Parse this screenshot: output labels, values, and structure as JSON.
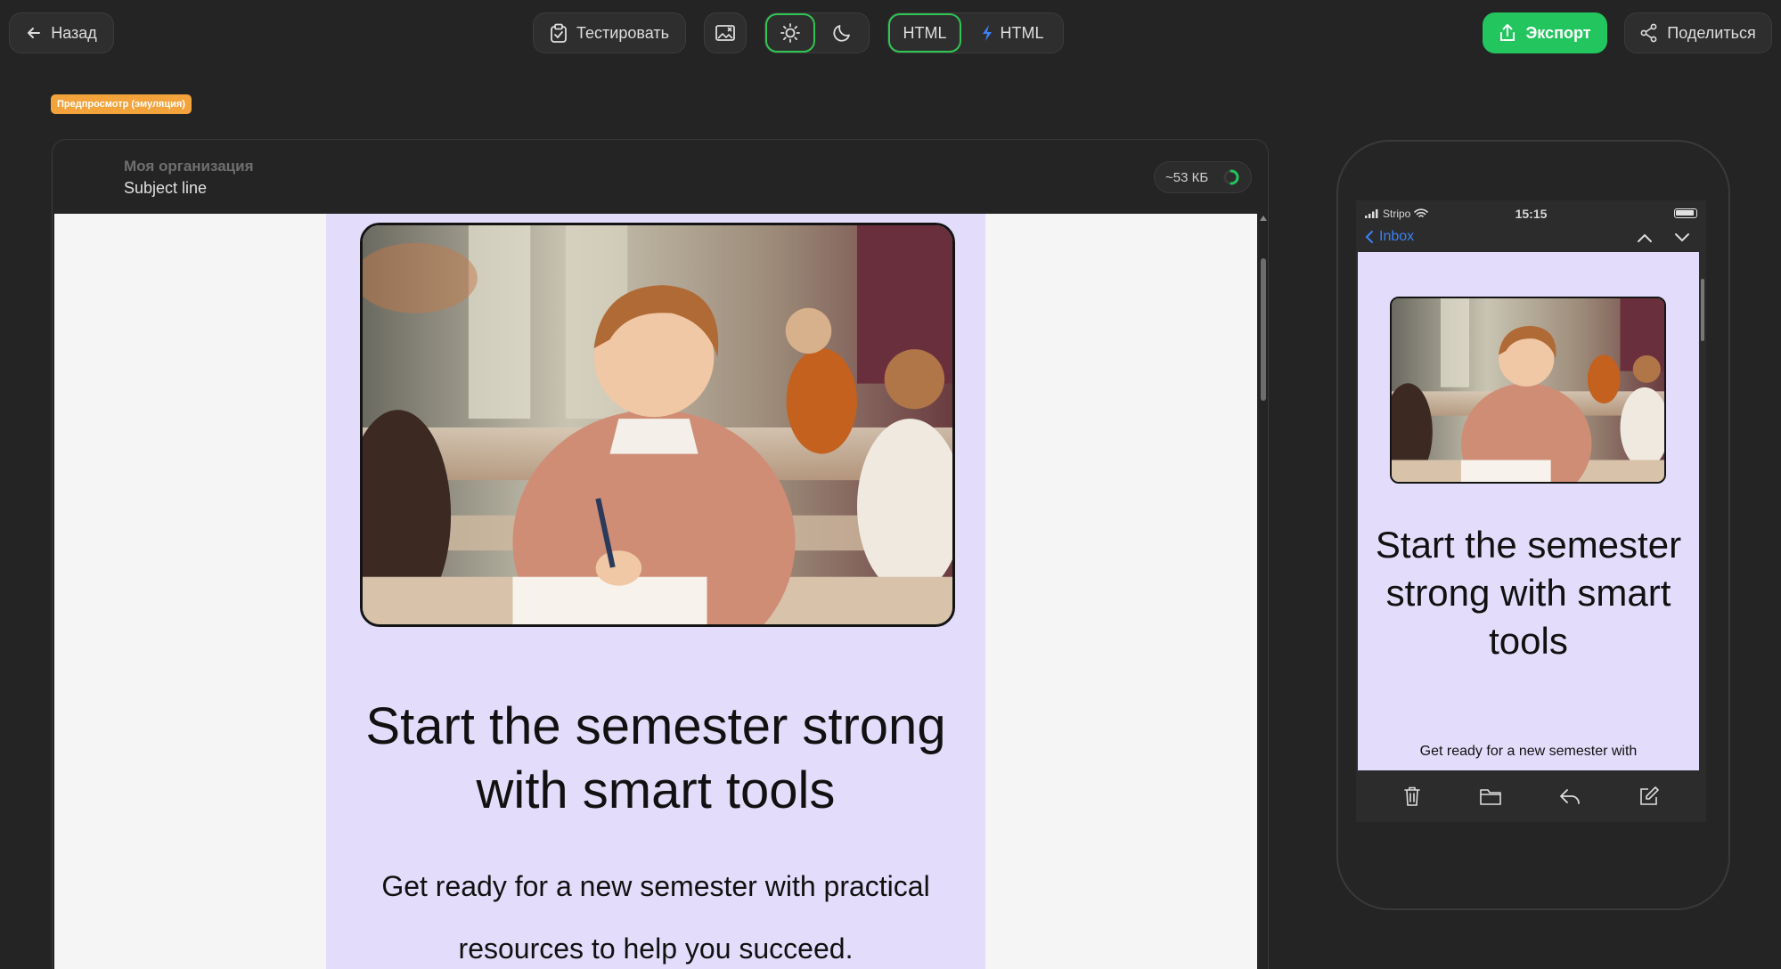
{
  "topbar": {
    "back_label": "Назад",
    "test_label": "Тестировать",
    "html_label": "HTML",
    "amp_html_label": "HTML",
    "export_label": "Экспорт",
    "share_label": "Поделиться"
  },
  "badge": "Предпросмотр (эмуляция)",
  "preview": {
    "organization": "Моя организация",
    "subject": "Subject line",
    "size": "~53 КБ"
  },
  "email": {
    "heading": "Start the semester strong with smart tools",
    "body": "Get ready for a new semester with practical resources to help you succeed.",
    "hero_image": "boy-writing-in-classroom"
  },
  "phone": {
    "carrier": "Stripo",
    "time": "15:15",
    "back_label": "Inbox",
    "heading": "Start the semester strong with smart tools",
    "snippet": "Get ready for a new semester with"
  },
  "colors": {
    "background": "#242424",
    "accent_green": "#22c55e",
    "badge_orange": "#f3a33b",
    "email_bg": "#e3ddfb",
    "link_blue": "#3b82f6"
  }
}
